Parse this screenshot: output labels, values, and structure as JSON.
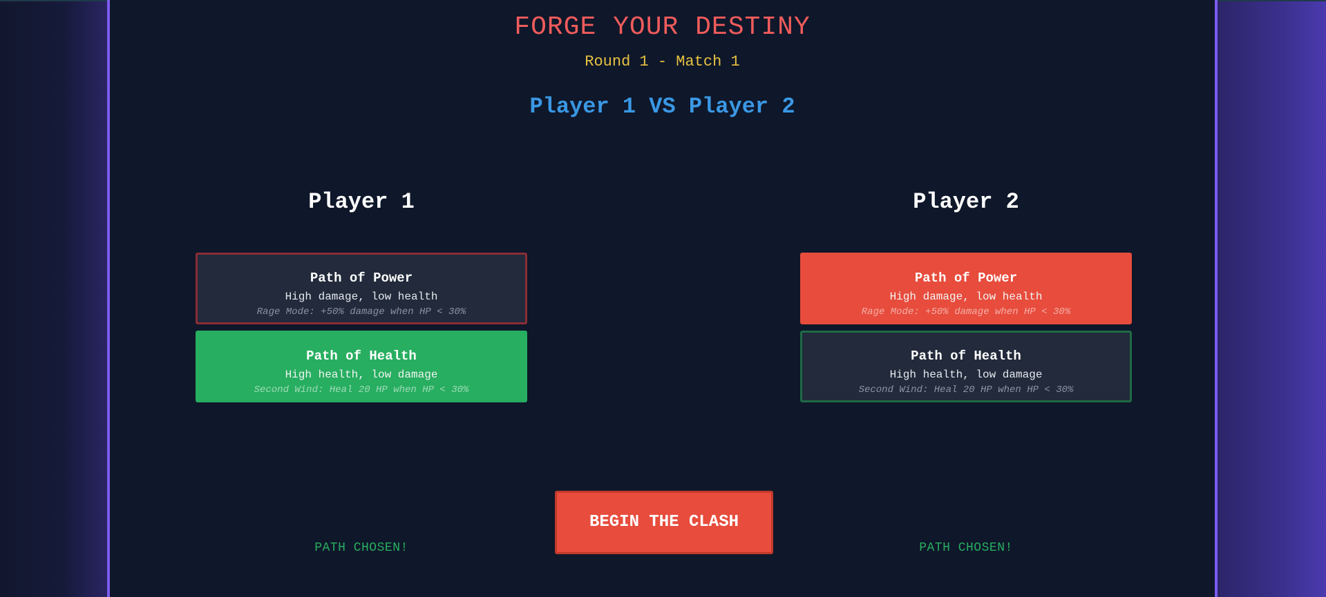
{
  "header": {
    "title": "FORGE YOUR DESTINY",
    "subtitle": "Round 1 - Match 1",
    "versus": "Player 1 VS Player 2"
  },
  "players": [
    {
      "name": "Player 1",
      "selected_path": "health",
      "status": "PATH CHOSEN!",
      "paths": [
        {
          "name": "Path of Power",
          "description": "High damage, low health",
          "ability": "Rage Mode: +50% damage when HP < 30%"
        },
        {
          "name": "Path of Health",
          "description": "High health, low damage",
          "ability": "Second Wind: Heal 20 HP when HP < 30%"
        }
      ]
    },
    {
      "name": "Player 2",
      "selected_path": "power",
      "status": "PATH CHOSEN!",
      "paths": [
        {
          "name": "Path of Power",
          "description": "High damage, low health",
          "ability": "Rage Mode: +50% damage when HP < 30%"
        },
        {
          "name": "Path of Health",
          "description": "High health, low damage",
          "ability": "Second Wind: Heal 20 HP when HP < 30%"
        }
      ]
    }
  ],
  "begin_button": {
    "label": "BEGIN THE CLASH"
  },
  "colors": {
    "background": "#0f172a",
    "title": "#f05c5c",
    "subtitle": "#e7c241",
    "versus": "#3a98e4",
    "power": "#e74c3c",
    "health": "#27ae60",
    "border_accent": "#7c5cf0"
  }
}
